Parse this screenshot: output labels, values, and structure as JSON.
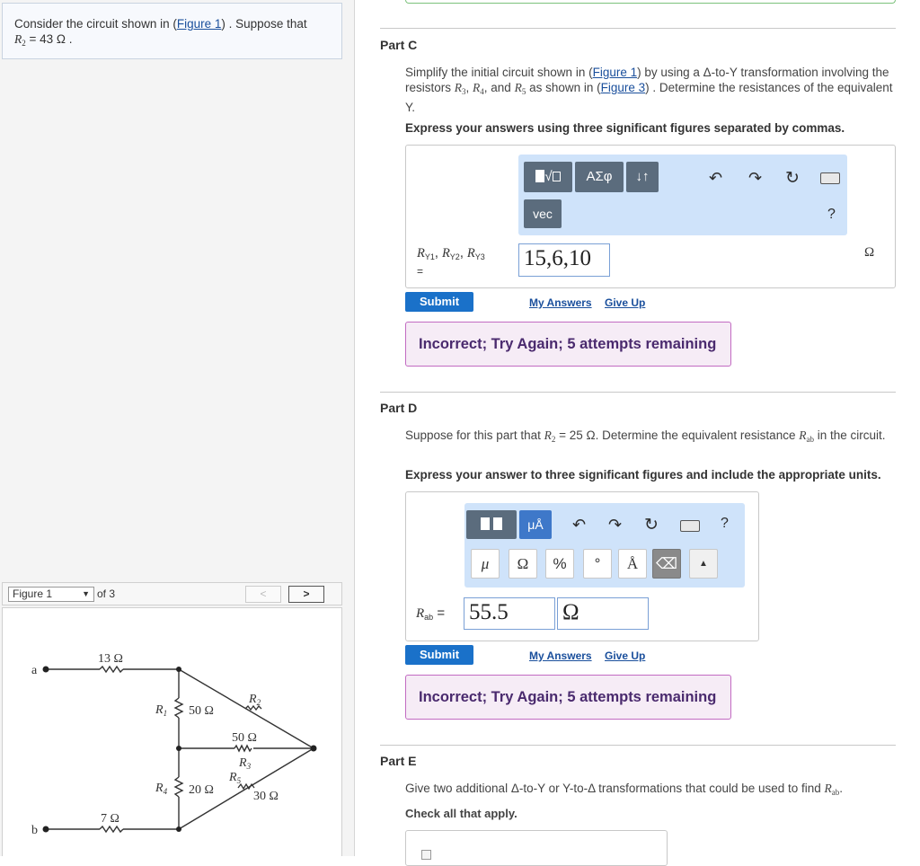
{
  "problem": {
    "text_prefix": "Consider the circuit shown in (",
    "figure_link": "Figure 1",
    "text_suffix": ") . Suppose that",
    "r2_label": "R",
    "r2_sub": "2",
    "r2_value": "= 43  Ω ."
  },
  "figure_nav": {
    "selected": "Figure 1",
    "of_label": "of 3",
    "prev": "<",
    "next": ">"
  },
  "circuit": {
    "node_a": "a",
    "node_b": "b",
    "r_top": "13 Ω",
    "r_bottom": "7 Ω",
    "r1_name": "R",
    "r1_sub": "1",
    "r1_value": "50 Ω",
    "r4_name": "R",
    "r4_sub": "4",
    "r4_value": "20 Ω",
    "r2_name": "R",
    "r2_sub": "2",
    "r3_value": "50 Ω",
    "r3_name": "R",
    "r3_sub": "3",
    "r5_name": "R",
    "r5_sub": "5",
    "r5_value": "30 Ω"
  },
  "part_c": {
    "title": "Part C",
    "desc_1": "Simplify the initial circuit shown in (",
    "link_1": "Figure 1",
    "desc_2": ") by using a Δ-to-Y transformation involving the resistors ",
    "desc_3": ", and ",
    "desc_4": " as shown in (",
    "link_2": "Figure 3",
    "desc_5": ") . Determine the resistances of the equivalent Y.",
    "instruction": "Express your answers using three significant figures separated by commas.",
    "toolbar_templates": "√",
    "toolbar_greek": "ΑΣφ",
    "toolbar_arrows": "↓↑",
    "toolbar_vec": "vec",
    "help": "?",
    "answer_label": "R",
    "answer_label_subs": "Y1, R",
    "answer_label_eq": "=",
    "answer_value": "15,6,10",
    "unit": "Ω",
    "submit": "Submit",
    "my_answers": "My Answers",
    "give_up": "Give Up",
    "feedback": "Incorrect; Try Again; 5 attempts remaining"
  },
  "part_d": {
    "title": "Part D",
    "desc_1": "Suppose for this part that ",
    "desc_2": " = 25 Ω. Determine the equivalent resistance ",
    "desc_3": " in the circuit.",
    "instruction": "Express your answer to three significant figures and include the appropriate units.",
    "toolbar_units": "μÅ",
    "help": "?",
    "sym_mu": "μ",
    "sym_omega": "Ω",
    "sym_percent": "%",
    "sym_degree": "°",
    "sym_angstrom": "Å",
    "sym_backspace": "⌫",
    "answer_label": "R",
    "answer_sub": "ab",
    "answer_eq": "=",
    "answer_value": "55.5",
    "answer_unit": "Ω",
    "submit": "Submit",
    "my_answers": "My Answers",
    "give_up": "Give Up",
    "feedback": "Incorrect; Try Again; 5 attempts remaining"
  },
  "part_e": {
    "title": "Part E",
    "desc_1": "Give two additional Δ-to-Y or Y-to-Δ transformations that could be used to find ",
    "desc_2": ".",
    "instruction": "Check all that apply."
  }
}
